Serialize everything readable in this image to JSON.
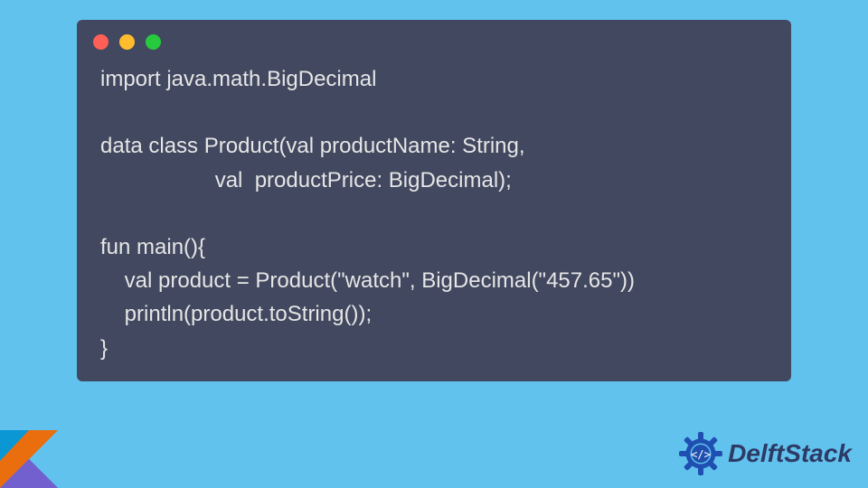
{
  "code": {
    "line1": "import java.math.BigDecimal",
    "line2": "",
    "line3": "data class Product(val productName: String,",
    "line4": "                   val  productPrice: BigDecimal);",
    "line5": "",
    "line6": "fun main(){",
    "line7": "    val product = Product(\"watch\", BigDecimal(\"457.65\"))",
    "line8": "    println(product.toString());",
    "line9": "}"
  },
  "brand": {
    "name": "DelftStack"
  }
}
